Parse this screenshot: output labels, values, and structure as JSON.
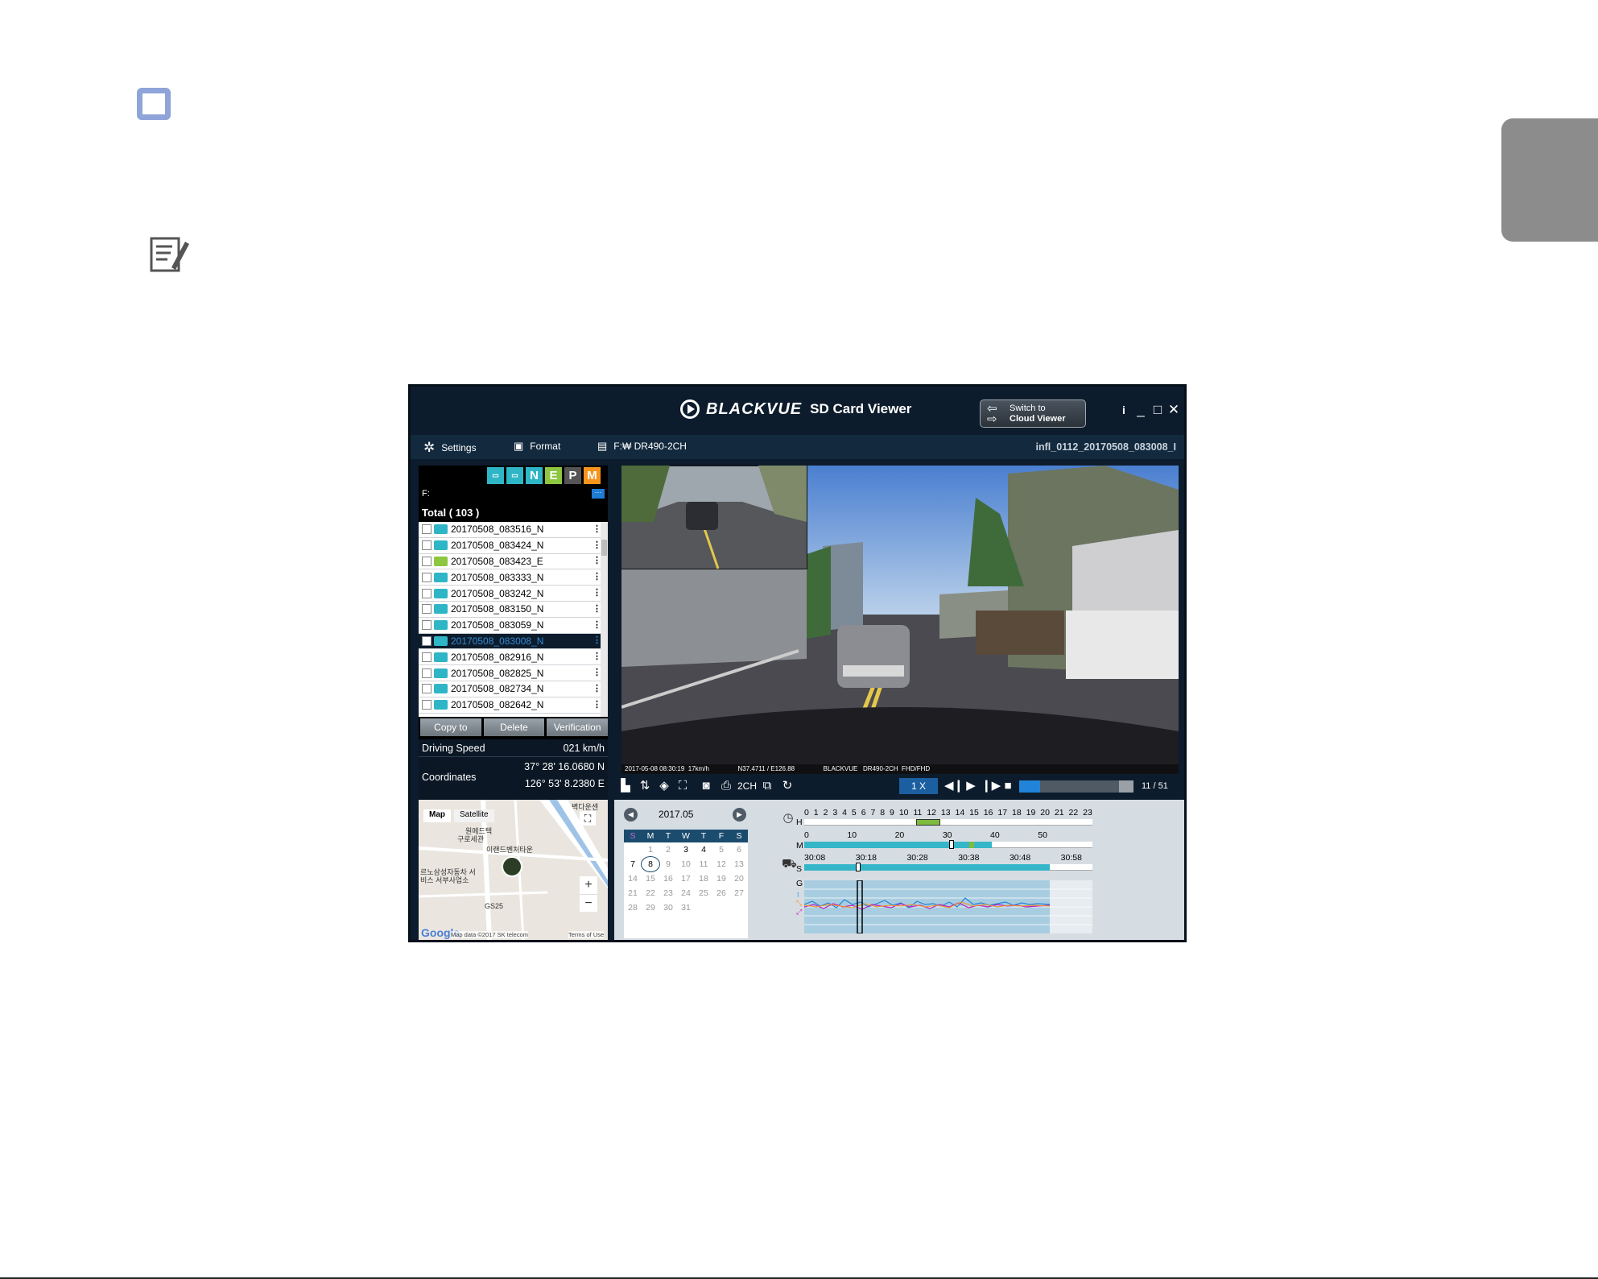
{
  "app": {
    "brand": "BLACKVUE",
    "title": "SD Card Viewer",
    "switch_line1": "Switch to",
    "switch_line2": "Cloud Viewer",
    "info_btn": "i",
    "minimize_btn": "_",
    "maximize_btn": "□",
    "close_btn": "✕"
  },
  "menu": {
    "settings": "Settings",
    "format": "Format",
    "drive": "F:₩ DR490-2CH",
    "current_file": "infl_0112_20170508_083008_I"
  },
  "filters": [
    "N",
    "E",
    "P",
    "M"
  ],
  "filter_colors": {
    "N": "#2fb6c6",
    "E": "#8dc63f",
    "P": "#555555",
    "M": "#f7941d"
  },
  "drive_path": "F:",
  "drive_more": "···",
  "total_label": "Total ( 103 )",
  "files": [
    "20170508_083516_N",
    "20170508_083424_N",
    "20170508_083423_E",
    "20170508_083333_N",
    "20170508_083242_N",
    "20170508_083150_N",
    "20170508_083059_N",
    "20170508_083008_N",
    "20170508_082916_N",
    "20170508_082825_N",
    "20170508_082734_N",
    "20170508_082642_N"
  ],
  "selected_file_index": 7,
  "buttons": {
    "copy": "Copy to",
    "delete": "Delete",
    "verify": "Verification"
  },
  "info": {
    "speed_label": "Driving Speed",
    "speed_value": "021 km/h",
    "coord_label": "Coordinates",
    "lat": "37° 28' 16.0680 N",
    "lon": "126° 53' 8.2380 E"
  },
  "map": {
    "tab_map": "Map",
    "tab_satellite": "Satellite",
    "zoom_in": "+",
    "zoom_out": "−",
    "google": "Google",
    "attribution": "Map data ©2017 SK telecom",
    "terms": "Terms of Use",
    "labels": [
      "원메드텍",
      "구로세관",
      "이랜드벤처타운",
      "르노삼성자동차 서비스 서부사업소",
      "GS25",
      "벽다운센"
    ]
  },
  "calendar": {
    "month": "2017.05",
    "days": [
      "S",
      "M",
      "T",
      "W",
      "T",
      "F",
      "S"
    ],
    "weeks": [
      [
        "",
        "1",
        "2",
        "3",
        "4",
        "5",
        "6"
      ],
      [
        "7",
        "8",
        "9",
        "10",
        "11",
        "12",
        "13"
      ],
      [
        "14",
        "15",
        "16",
        "17",
        "18",
        "19",
        "20"
      ],
      [
        "21",
        "22",
        "23",
        "24",
        "25",
        "26",
        "27"
      ],
      [
        "28",
        "29",
        "30",
        "31",
        "",
        "",
        ""
      ]
    ],
    "active_days": [
      "3",
      "4",
      "7",
      "8"
    ],
    "selected_day": "8"
  },
  "video": {
    "overlay": "2017-05-08 08:30:19  17km/h                N37.4711 / E126.88                BLACKVUE   DR490-2CH  FHD/FHD"
  },
  "controls": {
    "channel": "2CH",
    "speed": "1 X",
    "page": "11 / 51",
    "progress": 0.18
  },
  "timeline": {
    "hours": [
      "0",
      "1",
      "2",
      "3",
      "4",
      "5",
      "6",
      "7",
      "8",
      "9",
      "10",
      "11",
      "12",
      "13",
      "14",
      "15",
      "16",
      "17",
      "18",
      "19",
      "20",
      "21",
      "22",
      "23"
    ],
    "minutes": [
      "0",
      "10",
      "20",
      "30",
      "40",
      "50"
    ],
    "seconds": [
      "30:08",
      "30:18",
      "30:28",
      "30:38",
      "30:48",
      "30:58"
    ],
    "row_h": "H",
    "row_m": "M",
    "row_s": "S",
    "row_g": "G",
    "bar_color": "#35b6c8",
    "hour_marker_color": "#7dbb3c"
  }
}
